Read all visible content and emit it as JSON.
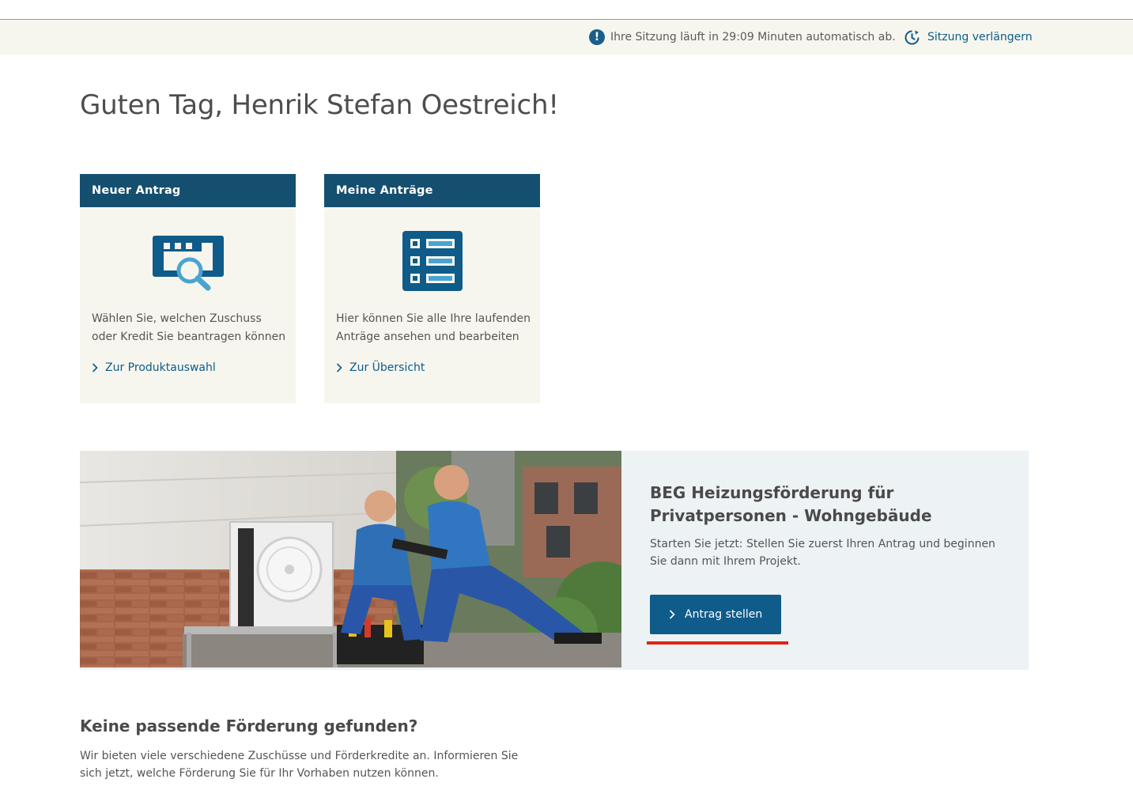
{
  "session": {
    "message": "Ihre Sitzung läuft in 29:09 Minuten automatisch ab.",
    "extend_label": "Sitzung verlängern",
    "icons": [
      "exclamation-icon",
      "clock-refresh-icon"
    ]
  },
  "greeting": "Guten Tag, Henrik Stefan Oestreich!",
  "cards": [
    {
      "title": "Neuer Antrag",
      "icon": "document-search-icon",
      "description": "Wählen Sie, welchen Zuschuss oder Kredit Sie beantragen können",
      "link_label": "Zur Produktauswahl"
    },
    {
      "title": "Meine Anträge",
      "icon": "list-icon",
      "description": "Hier können Sie alle Ihre laufenden Anträge ansehen und bearbeiten",
      "link_label": "Zur Übersicht"
    }
  ],
  "promo": {
    "image": "technicians-heat-pump-photo",
    "title": "BEG Heizungsförderung für Privatpersonen - Wohngebäude",
    "text": "Starten Sie jetzt: Stellen Sie zuerst Ihren Antrag und beginnen Sie dann mit Ihrem Projekt.",
    "button_label": "Antrag stellen"
  },
  "no_match": {
    "title": "Keine passende Förderung gefunden?",
    "text": "Wir bieten viele verschiedene Zuschüsse und Förderkredite an. Informieren Sie sich jetzt, welche Förderung Sie für Ihr Vorhaben nutzen können."
  },
  "colors": {
    "primary": "#154f70",
    "link": "#0b5c8c",
    "card_bg": "#f7f6ee",
    "promo_bg": "#edf2f4",
    "highlight": "#e2231a"
  }
}
